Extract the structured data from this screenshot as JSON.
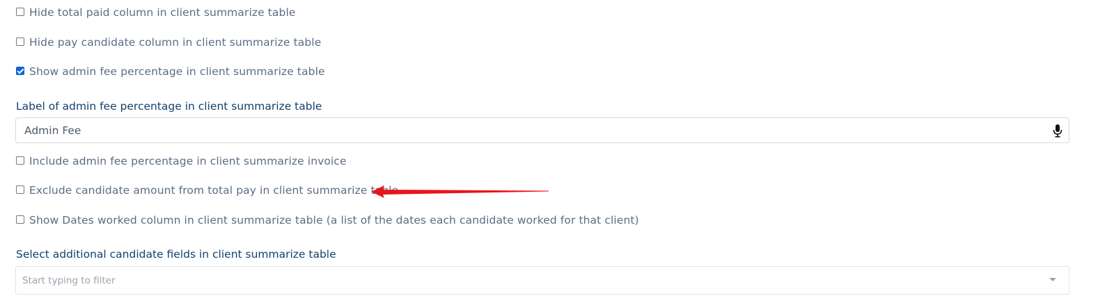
{
  "options": [
    {
      "label": "Hide total paid column in client summarize table",
      "checked": false
    },
    {
      "label": "Hide pay candidate column in client summarize table",
      "checked": false
    },
    {
      "label": "Show admin fee percentage in client summarize table",
      "checked": true
    },
    {
      "label": "Include admin fee percentage in client summarize invoice",
      "checked": false
    },
    {
      "label": "Exclude candidate amount from total pay in client summarize table",
      "checked": false
    },
    {
      "label": "Show Dates worked column in client summarize table (a list of the dates each candidate worked for that client)",
      "checked": false
    }
  ],
  "admin_fee_label": {
    "label": "Label of admin fee percentage in client summarize table",
    "value": "Admin Fee",
    "icon": "microphone-icon"
  },
  "additional_fields": {
    "label": "Select additional candidate fields in client summarize table",
    "placeholder": "Start typing to filter",
    "icon": "chevron-down-icon"
  },
  "annotation": {
    "icon": "red-arrow-icon",
    "color": "#e8141b"
  },
  "colors": {
    "label_text": "#5b6c86",
    "field_label": "#12406b",
    "checkbox_checked": "#0a66d8"
  }
}
